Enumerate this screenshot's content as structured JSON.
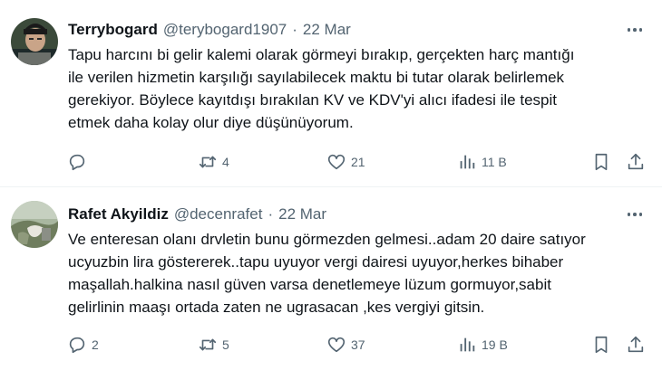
{
  "tweets": [
    {
      "name": "Terrybogard",
      "handle": "@terybogard1907",
      "separator": "·",
      "date": "22 Mar",
      "text": "Tapu harcını bi gelir kalemi olarak görmeyi bırakıp, gerçekten harç mantığı\nile verilen hizmetin karşılığı sayılabilecek maktu bi tutar olarak belirlemek\ngerekiyor.  Böylece kayıtdışı bırakılan KV ve KDV'yi alıcı ifadesi ile tespit\netmek daha kolay olur diye düşünüyorum.",
      "replies": "",
      "retweets": "4",
      "likes": "21",
      "views": "11 B"
    },
    {
      "name": "Rafet Akyildiz",
      "handle": "@decenrafet",
      "separator": "·",
      "date": "22 Mar",
      "text": "Ve enteresan olanı drvletin bunu görmezden gelmesi..adam 20 daire satıyor\nucyuzbin lira göstererek..tapu uyuyor vergi dairesi uyuyor,herkes bihaber\nmaşallah.halkina nasıl güven varsa denetlemeye lüzum gormuyor,sabit\ngelirlinin maaşı ortada zaten ne ugrasacan ,kes vergiyi gitsin.",
      "replies": "2",
      "retweets": "5",
      "likes": "37",
      "views": "19 B"
    }
  ],
  "colors": {
    "text": "#0f1419",
    "secondary": "#536471",
    "divider": "#eff3f4"
  },
  "icons": [
    "reply-icon",
    "retweet-icon",
    "like-icon",
    "views-icon",
    "bookmark-icon",
    "share-icon",
    "more-icon"
  ]
}
